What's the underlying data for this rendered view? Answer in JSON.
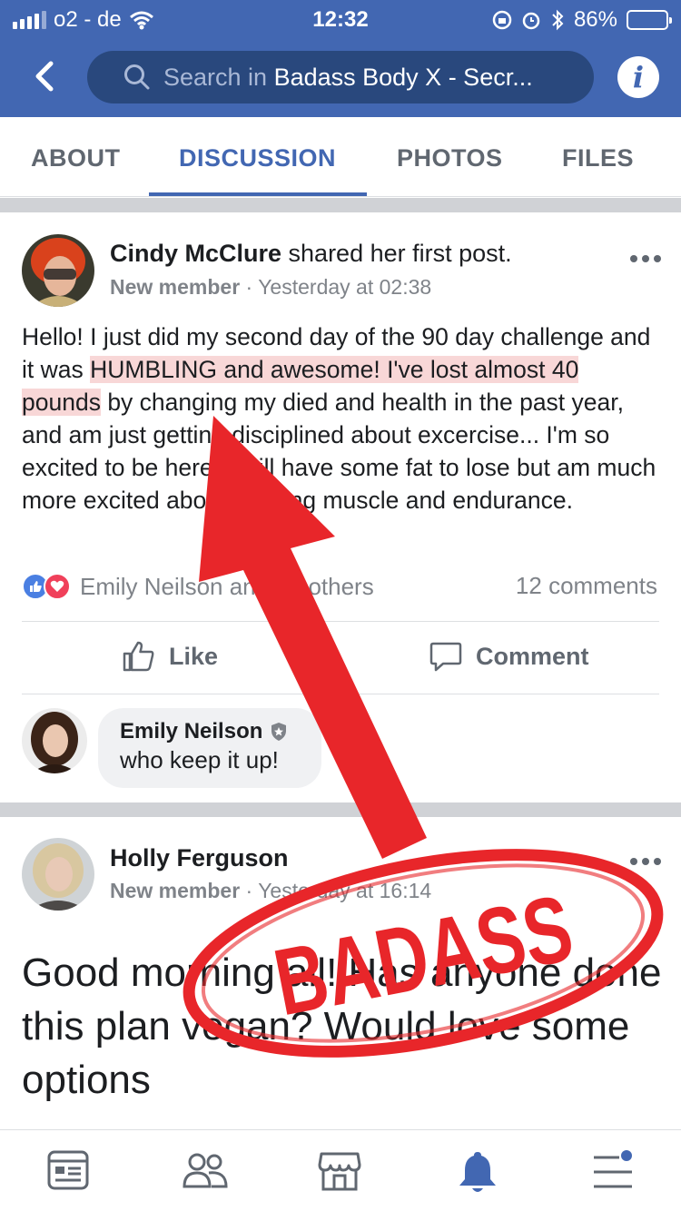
{
  "status": {
    "carrier": "o2 - de",
    "time": "12:32",
    "battery": "86%",
    "battery_level": 0.86
  },
  "header": {
    "search_placeholder": "Search in ",
    "search_group": "Badass Body X - Secr...",
    "back_icon": "chevron-left-icon",
    "info_icon": "info-icon",
    "info_glyph": "i"
  },
  "tabs": [
    {
      "label": "ABOUT"
    },
    {
      "label": "DISCUSSION",
      "active": true
    },
    {
      "label": "PHOTOS"
    },
    {
      "label": "FILES"
    }
  ],
  "post1": {
    "author": "Cindy McClure",
    "action": " shared her first post.",
    "role": "New member",
    "time": "Yesterday at 02:38",
    "text_a": "Hello!  I just did my second day of the 90 day challenge and it was ",
    "text_highlight": "HUMBLING and awesome!  I've lost almost 40 pounds",
    "text_b": " by changing my died and health in the past year, and am just getting disciplined about excercise... I'm so excited to be here!  I still have some fat to lose but am much more excited about building muscle and endurance.",
    "reactions_text": "Emily Neilson and 18 others",
    "comments": "12 comments",
    "like_label": "Like",
    "comment_label": "Comment",
    "reply": {
      "name": "Emily Neilson",
      "text": "who keep it up!"
    }
  },
  "post2": {
    "author": "Holly Ferguson",
    "role": "New member",
    "time": "Yesterday at 16:14",
    "text": "Good morning all! Has anyone done this plan vegan? Would love some options"
  },
  "annotation": {
    "stamp_text": "BADASS",
    "color": "#e8262a"
  },
  "bottom_nav": [
    {
      "icon": "news-feed-icon"
    },
    {
      "icon": "groups-icon"
    },
    {
      "icon": "marketplace-icon"
    },
    {
      "icon": "notifications-bell-icon",
      "active": true
    },
    {
      "icon": "menu-icon",
      "badge": true
    }
  ],
  "colors": {
    "brand": "#4267b2",
    "highlight": "#f8d7d7",
    "muted": "#7f8389"
  }
}
